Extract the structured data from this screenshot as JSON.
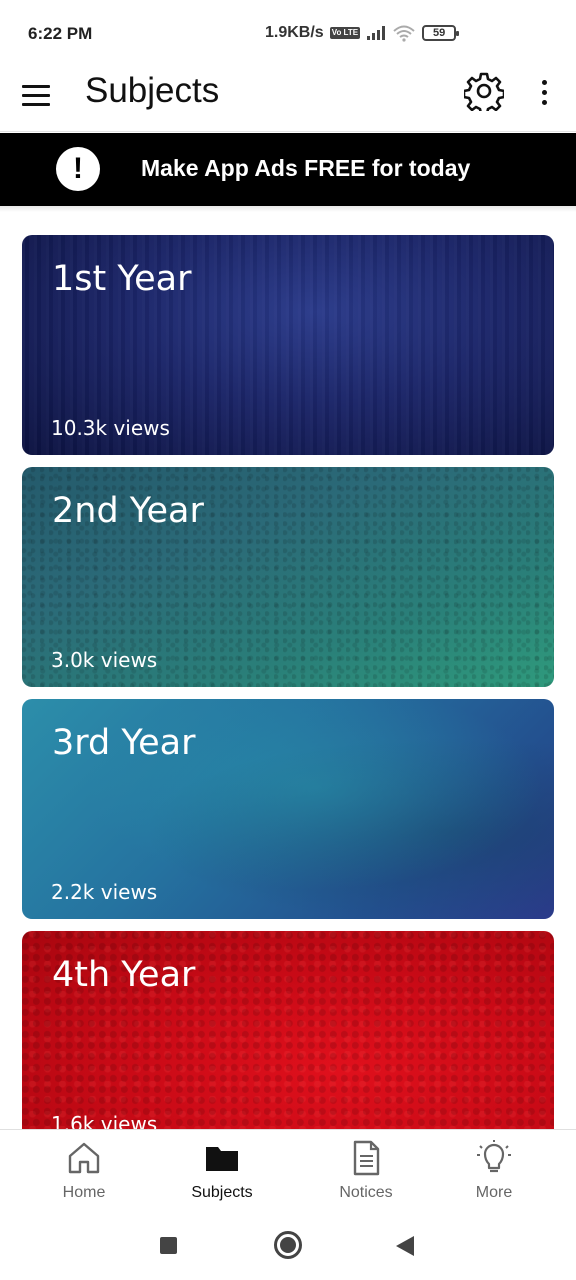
{
  "status_bar": {
    "time": "6:22 PM",
    "network_speed": "1.9KB/s",
    "volte": "Vo LTE",
    "battery": "59"
  },
  "app_bar": {
    "title": "Subjects",
    "menu_icon": "hamburger-menu-icon",
    "settings_icon": "gear-icon",
    "overflow_icon": "more-vertical-icon"
  },
  "promo": {
    "icon": "!",
    "text": "Make App Ads FREE for today"
  },
  "cards": [
    {
      "title": "1st Year",
      "views": "10.3k views",
      "color": "#1b2568"
    },
    {
      "title": "2nd Year",
      "views": "3.0k views",
      "color": "#2a7f79"
    },
    {
      "title": "3rd Year",
      "views": "2.2k views",
      "color": "#2573a0"
    },
    {
      "title": "4th Year",
      "views": "1.6k views",
      "color": "#c80a16"
    }
  ],
  "bottom_nav": [
    {
      "label": "Home",
      "icon": "home-icon",
      "active": false
    },
    {
      "label": "Subjects",
      "icon": "folder-icon",
      "active": true
    },
    {
      "label": "Notices",
      "icon": "document-icon",
      "active": false
    },
    {
      "label": "More",
      "icon": "lightbulb-icon",
      "active": false
    }
  ],
  "colors": {
    "banner_bg": "#000000",
    "text_primary": "#111111",
    "nav_inactive": "#666666"
  }
}
